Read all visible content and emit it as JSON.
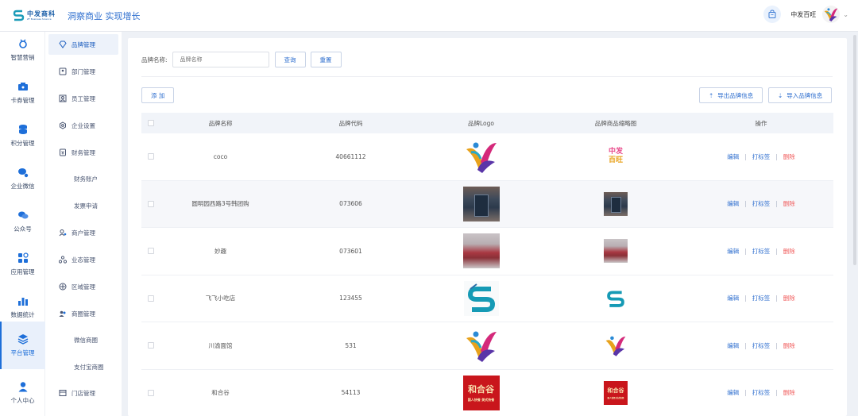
{
  "header": {
    "logo_cn": "中发商科",
    "logo_en": "ZF Business Science",
    "slogan": "洞察商业 实现增长",
    "user_name": "中发百旺"
  },
  "sidebar_main": [
    {
      "label": "智慧营销",
      "icon": "bulb-icon"
    },
    {
      "label": "卡券管理",
      "icon": "coupon-icon"
    },
    {
      "label": "积分管理",
      "icon": "coins-icon"
    },
    {
      "label": "企业微信",
      "icon": "wechat-work-icon"
    },
    {
      "label": "公众号",
      "icon": "chat-bubbles-icon"
    },
    {
      "label": "应用管理",
      "icon": "apps-grid-icon"
    },
    {
      "label": "数据统计",
      "icon": "bar-chart-icon"
    },
    {
      "label": "平台管理",
      "icon": "layers-icon",
      "active": true
    },
    {
      "label": "个人中心",
      "icon": "person-icon"
    }
  ],
  "sidebar_sub": [
    {
      "label": "品牌管理",
      "icon": "diamond-icon",
      "active": true
    },
    {
      "label": "部门管理",
      "icon": "department-icon"
    },
    {
      "label": "员工管理",
      "icon": "employee-icon"
    },
    {
      "label": "企业设置",
      "icon": "settings-icon"
    },
    {
      "label": "财务管理",
      "icon": "finance-icon"
    },
    {
      "label": "财务账户",
      "sub": true
    },
    {
      "label": "发票申请",
      "sub": true
    },
    {
      "label": "商户管理",
      "icon": "merchant-icon"
    },
    {
      "label": "业态管理",
      "icon": "format-icon"
    },
    {
      "label": "区域管理",
      "icon": "region-icon"
    },
    {
      "label": "商圈管理",
      "icon": "business-circle-icon"
    },
    {
      "label": "微信商圈",
      "sub": true
    },
    {
      "label": "支付宝商圈",
      "sub": true
    },
    {
      "label": "门店管理",
      "icon": "store-icon"
    }
  ],
  "search": {
    "label": "品牌名称:",
    "placeholder": "品牌名称",
    "query_btn": "查询",
    "reset_btn": "重置"
  },
  "toolbar": {
    "add_btn": "添 加",
    "export_btn": "导出品牌信息",
    "import_btn": "导入品牌信息"
  },
  "table": {
    "headers": [
      "品牌名称",
      "品牌代码",
      "品牌Logo",
      "品牌商品缩略图",
      "操作"
    ],
    "actions": {
      "edit": "编辑",
      "tag": "打标签",
      "delete": "删除"
    },
    "rows": [
      {
        "name": "coco",
        "code": "40661112",
        "logo": "zf-colorful-logo",
        "thumb": "zf-text-logo"
      },
      {
        "name": "圆明园西路3号韩团购",
        "code": "073606",
        "logo": "storefront-photo",
        "thumb": "storefront-photo"
      },
      {
        "name": "妙趣",
        "code": "073601",
        "logo": "mall-photo",
        "thumb": "mall-photo"
      },
      {
        "name": "飞飞小吃店",
        "code": "123455",
        "logo": "s-logo",
        "thumb": "s-logo"
      },
      {
        "name": "川渝面馆",
        "code": "531",
        "logo": "zf-colorful-logo",
        "thumb": "zf-colorful-logo"
      },
      {
        "name": "和合谷",
        "code": "54113",
        "logo": "hehegu-logo",
        "thumb": "hehegu-logo"
      }
    ]
  },
  "zf_text_logo": {
    "line1": "中发",
    "line2": "百旺"
  },
  "hehegu": {
    "title": "和合谷",
    "tagline": "国人快餐 美式快餐"
  },
  "colors": {
    "accent": "#2f6fcf",
    "danger": "#f05a5a",
    "sidebar_active": "#1e6fd9"
  }
}
